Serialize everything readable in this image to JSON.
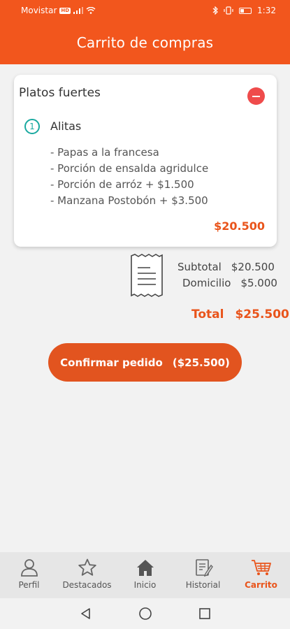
{
  "status_bar": {
    "carrier": "Movistar",
    "network_badge": "HD",
    "time": "1:32"
  },
  "header": {
    "title": "Carrito de compras"
  },
  "cart": {
    "category": "Platos fuertes",
    "item": {
      "quantity": "1",
      "name": "Alitas",
      "options": [
        "- Papas a la francesa",
        "- Porción de ensalda agridulce",
        "- Porción de arróz + $1.500",
        "- Manzana Postobón + $3.500"
      ],
      "price": "$20.500"
    }
  },
  "summary": {
    "subtotal_label": "Subtotal",
    "subtotal_value": "$20.500",
    "delivery_label": "Domicilio",
    "delivery_value": "$5.000",
    "total_label": "Total",
    "total_value": "$25.500"
  },
  "confirm_button": {
    "label": "Confirmar pedido",
    "amount": "($25.500)"
  },
  "bottom_nav": {
    "items": [
      {
        "label": "Perfil",
        "icon": "user-icon",
        "active": false
      },
      {
        "label": "Destacados",
        "icon": "star-icon",
        "active": false
      },
      {
        "label": "Inicio",
        "icon": "home-icon",
        "active": false
      },
      {
        "label": "Historial",
        "icon": "history-icon",
        "active": false
      },
      {
        "label": "Carrito",
        "icon": "cart-icon",
        "active": true
      }
    ]
  },
  "colors": {
    "brand": "#f2561d",
    "accent_text": "#e9541b",
    "remove": "#ef4b4b",
    "qty_teal": "#1aa9a0"
  }
}
